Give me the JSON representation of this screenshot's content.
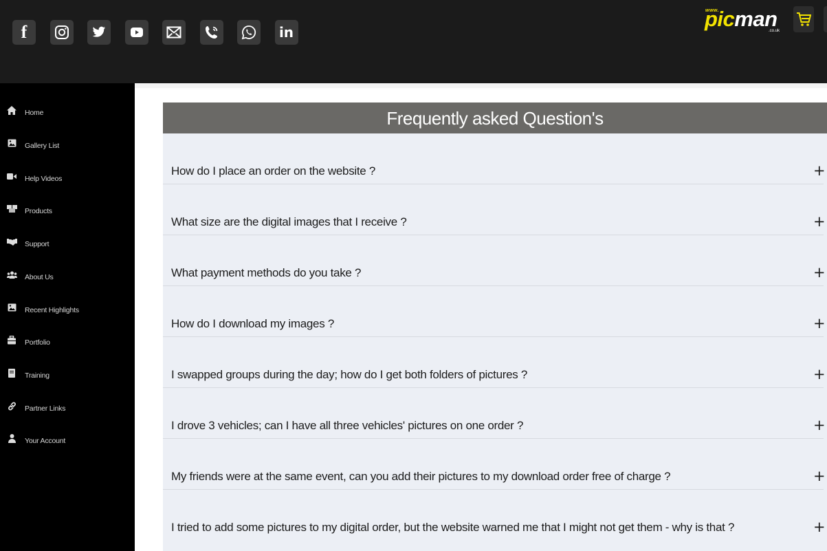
{
  "social_icons": [
    {
      "name": "facebook-icon",
      "glyph": "f"
    },
    {
      "name": "instagram-icon",
      "glyph": ""
    },
    {
      "name": "twitter-icon",
      "glyph": ""
    },
    {
      "name": "youtube-icon",
      "glyph": ""
    },
    {
      "name": "email-icon",
      "glyph": ""
    },
    {
      "name": "phone-icon",
      "glyph": ""
    },
    {
      "name": "whatsapp-icon",
      "glyph": ""
    },
    {
      "name": "linkedin-icon",
      "glyph": "in"
    }
  ],
  "logo": {
    "www": "www.",
    "pic": "pic",
    "man": "man",
    "tld": ".co.uk"
  },
  "sidebar": {
    "items": [
      {
        "label": "Home",
        "icon": "home-icon"
      },
      {
        "label": "Gallery List",
        "icon": "image-icon"
      },
      {
        "label": "Help Videos",
        "icon": "video-camera-icon"
      },
      {
        "label": "Products",
        "icon": "boxes-icon"
      },
      {
        "label": "Support",
        "icon": "handshake-icon"
      },
      {
        "label": "About Us",
        "icon": "users-icon"
      },
      {
        "label": "Recent Highlights",
        "icon": "image-icon"
      },
      {
        "label": "Portfolio",
        "icon": "briefcase-icon"
      },
      {
        "label": "Training",
        "icon": "book-icon"
      },
      {
        "label": "Partner Links",
        "icon": "link-icon"
      },
      {
        "label": "Your Account",
        "icon": "user-icon"
      }
    ]
  },
  "faq": {
    "title": "Frequently asked Question's",
    "expand_symbol": "+",
    "items": [
      "How do I place an order on the website ?",
      "What size are the digital images that I receive ?",
      "What payment methods do you take ?",
      "How do I download my images ?",
      "I swapped groups during the day; how do I get both folders of pictures ?",
      "I drove 3 vehicles; can I have all three vehicles' pictures on one order ?",
      "My friends were at the same event, can you add their pictures to my download order free of charge ?",
      "I tried to add some pictures to my digital order, but the website warned me that I might not get them - why is that ?"
    ]
  },
  "colors": {
    "topbar": "#1b1b1b",
    "sidebar": "#000000",
    "brand_yellow": "#f2e200",
    "faq_header": "#6a6966",
    "faq_body": "#eceff5"
  }
}
